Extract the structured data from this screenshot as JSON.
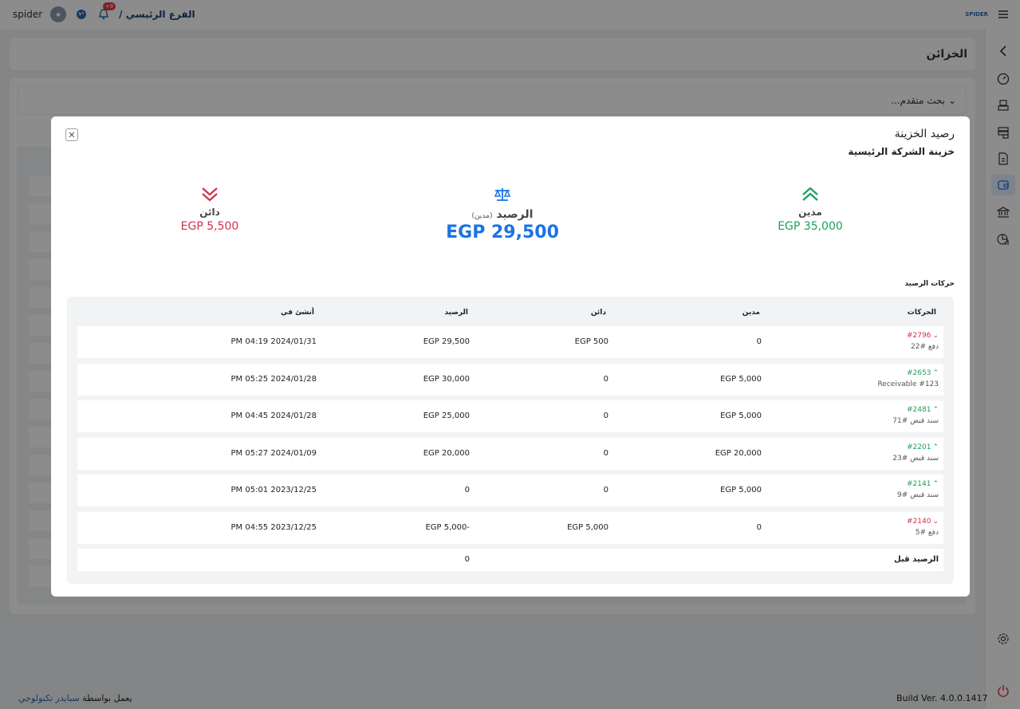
{
  "topbar": {
    "user_name": "spider",
    "notification_count": "+9",
    "branch": "الفرع الرئيسي /",
    "logo_text": "SPIDER"
  },
  "page": {
    "title": "الخزائن",
    "advanced_search": "بحث متقدم..."
  },
  "footer": {
    "powered_by": "يعمل بواسطة",
    "brand": "سبايدر تكنولوجي",
    "build": "Build Ver. 4.0.0.1417"
  },
  "modal": {
    "title": "رصيد الخزينة",
    "subtitle": "خزينة الشركة الرئيسية",
    "credit": {
      "label": "دائن",
      "value": "EGP 5,500"
    },
    "debit": {
      "label": "مدين",
      "value": "EGP 35,000"
    },
    "balance": {
      "label": "الرصيد",
      "note": "(مدين)",
      "value": "EGP 29,500"
    },
    "movements_title": "حركات الرصيد",
    "columns": {
      "movements": "الحركات",
      "debit": "مدين",
      "credit": "دائن",
      "balance": "الرصيد",
      "created_at": "أنشئ في"
    },
    "rows": [
      {
        "ref": "#2796",
        "direction": "out",
        "desc": "دفع #22",
        "debit": "0",
        "credit": "EGP 500",
        "balance": "EGP 29,500",
        "date": "PM 04:19 2024/01/31"
      },
      {
        "ref": "#2653",
        "direction": "in",
        "desc": "Receivable #123",
        "debit": "EGP 5,000",
        "credit": "0",
        "balance": "EGP 30,000",
        "date": "PM 05:25 2024/01/28"
      },
      {
        "ref": "#2481",
        "direction": "in",
        "desc": "سند قبض #71",
        "debit": "EGP 5,000",
        "credit": "0",
        "balance": "EGP 25,000",
        "date": "PM 04:45 2024/01/28"
      },
      {
        "ref": "#2201",
        "direction": "in",
        "desc": "سند قبض #23",
        "debit": "EGP 20,000",
        "credit": "0",
        "balance": "EGP 20,000",
        "date": "PM 05:27 2024/01/09"
      },
      {
        "ref": "#2141",
        "direction": "in",
        "desc": "سند قبض #9",
        "debit": "EGP 5,000",
        "credit": "0",
        "balance": "0",
        "date": "PM 05:01 2023/12/25"
      },
      {
        "ref": "#2140",
        "direction": "out",
        "desc": "دفع #5",
        "debit": "0",
        "credit": "EGP 5,000",
        "balance": "EGP 5,000-",
        "date": "PM 04:55 2023/12/25"
      }
    ],
    "previous_balance": {
      "label": "الرصيد قبل",
      "value": "0"
    }
  },
  "colors": {
    "debit": "#1e9e5a",
    "credit": "#d0324a",
    "balance": "#1a73e8",
    "accent": "#1f3f7a"
  },
  "icons": {
    "sidebar": [
      "collapse-arrow-icon",
      "dashboard-icon",
      "pos-icon",
      "storage-icon",
      "document-icon",
      "wallet-icon",
      "bank-icon",
      "reports-icon",
      "settings-icon",
      "power-icon"
    ]
  }
}
